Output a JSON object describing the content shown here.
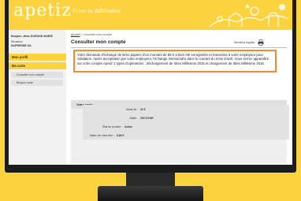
{
  "header": {
    "logo": "apetiz",
    "tagline": "Vivez la différence"
  },
  "sidebar": {
    "user_name": "Bonjour, Mme DURAND MARIE",
    "org_label": "Structure",
    "org_name": "SAPRESNE SA",
    "items": [
      {
        "label": "Mon profil",
        "active": true
      },
      {
        "label": "Ma carte",
        "active": true
      }
    ],
    "sub_items": [
      {
        "label": "Consulter mon compte"
      },
      {
        "label": "Bloquer carte"
      }
    ]
  },
  "breadcrumb": {
    "home": "Accueil",
    "separator": " > ",
    "current": "Consulter mon compte"
  },
  "page_title": "Consulter mon compte",
  "print_label": "Mentions légales",
  "notice_text": "Votre demande d'échange de titres papiers d'un montant de 88 € a bien été enregistrée et transmise à votre employeur pour validation. Après acceptation par votre employeur, l'échange interviendra dans le courant du mois d'avril. Vous verrez apparaître sur votre compte Apetiz 2 types d'opérations : déchargement de titres Millésime 2015 et chargement de titres Millésime 2016.",
  "card": {
    "title": "Votre carte",
    "rows": [
      {
        "label": "Solde lié :",
        "value": "20 €"
      },
      {
        "label": "Solde :",
        "value": "200 € EUR"
      },
      {
        "label": "État de la carte :",
        "value": "Active"
      },
      {
        "label": "Valeur de votre titre :",
        "value": "8,80 €"
      }
    ]
  },
  "colors": {
    "brand_yellow": "#fdd23f",
    "notice_border": "#f28b2a"
  }
}
